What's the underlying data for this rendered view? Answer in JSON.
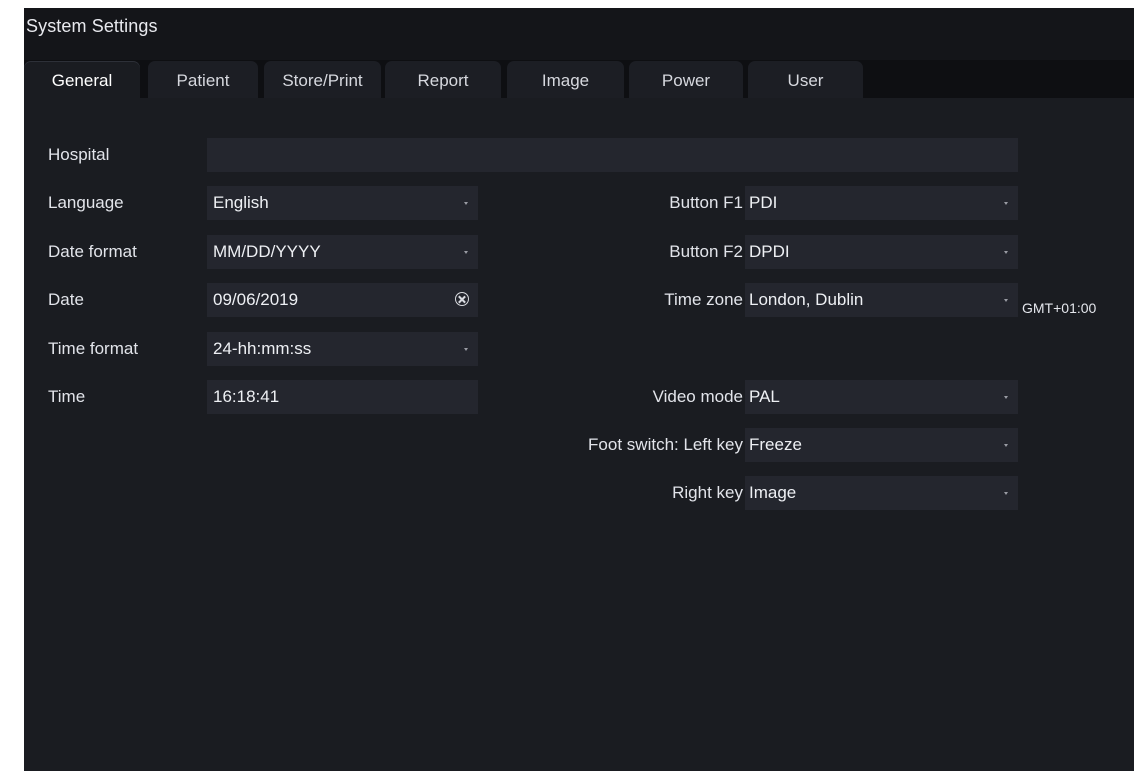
{
  "window": {
    "title": "System Settings"
  },
  "tabs": [
    {
      "label": "General",
      "active": true
    },
    {
      "label": "Patient",
      "active": false
    },
    {
      "label": "Store/Print",
      "active": false
    },
    {
      "label": "Report",
      "active": false
    },
    {
      "label": "Image",
      "active": false
    },
    {
      "label": "Power",
      "active": false
    },
    {
      "label": "User",
      "active": false
    }
  ],
  "general": {
    "hospital": {
      "label": "Hospital",
      "value": ""
    },
    "language": {
      "label": "Language",
      "value": "English"
    },
    "date_format": {
      "label": "Date format",
      "value": "MM/DD/YYYY"
    },
    "date": {
      "label": "Date",
      "value": "09/06/2019"
    },
    "time_format": {
      "label": "Time format",
      "value": "24-hh:mm:ss"
    },
    "time": {
      "label": "Time",
      "value": "16:18:41"
    },
    "button_f1": {
      "label": "Button F1",
      "value": "PDI"
    },
    "button_f2": {
      "label": "Button F2",
      "value": "DPDI"
    },
    "time_zone": {
      "label": "Time zone",
      "value": "London, Dublin",
      "offset": "GMT+01:00"
    },
    "video_mode": {
      "label": "Video mode",
      "value": "PAL"
    },
    "foot_switch_left": {
      "label": "Foot switch: Left key",
      "value": "Freeze"
    },
    "foot_switch_right": {
      "label": "Right key",
      "value": "Image"
    }
  },
  "icons": {
    "dropdown": "chevron-down-icon",
    "clear": "clear-circle-icon"
  },
  "colors": {
    "background": "#1a1c21",
    "field": "#24262e",
    "tab": "#1c1e24",
    "text": "#e2e4ea"
  }
}
